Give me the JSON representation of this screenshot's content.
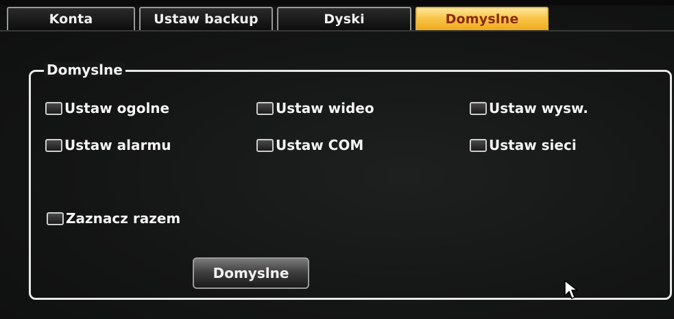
{
  "tabs": [
    {
      "label": "Konta",
      "active": false
    },
    {
      "label": "Ustaw backup",
      "active": false
    },
    {
      "label": "Dyski",
      "active": false
    },
    {
      "label": "Domyslne",
      "active": true
    }
  ],
  "panel": {
    "title": "Domyslne",
    "options": [
      {
        "label": "Ustaw ogolne",
        "checked": false
      },
      {
        "label": "Ustaw wideo",
        "checked": false
      },
      {
        "label": "Ustaw wysw.",
        "checked": false
      },
      {
        "label": "Ustaw alarmu",
        "checked": false
      },
      {
        "label": "Ustaw COM",
        "checked": false
      },
      {
        "label": "Ustaw sieci",
        "checked": false
      }
    ],
    "select_all": {
      "label": "Zaznacz razem",
      "checked": false
    },
    "button_label": "Domyslne"
  },
  "colors": {
    "active_tab": "#f8c54a",
    "active_tab_text": "#8a2a10",
    "background": "#141414"
  },
  "icons": {
    "cursor": "mouse-pointer-icon"
  }
}
